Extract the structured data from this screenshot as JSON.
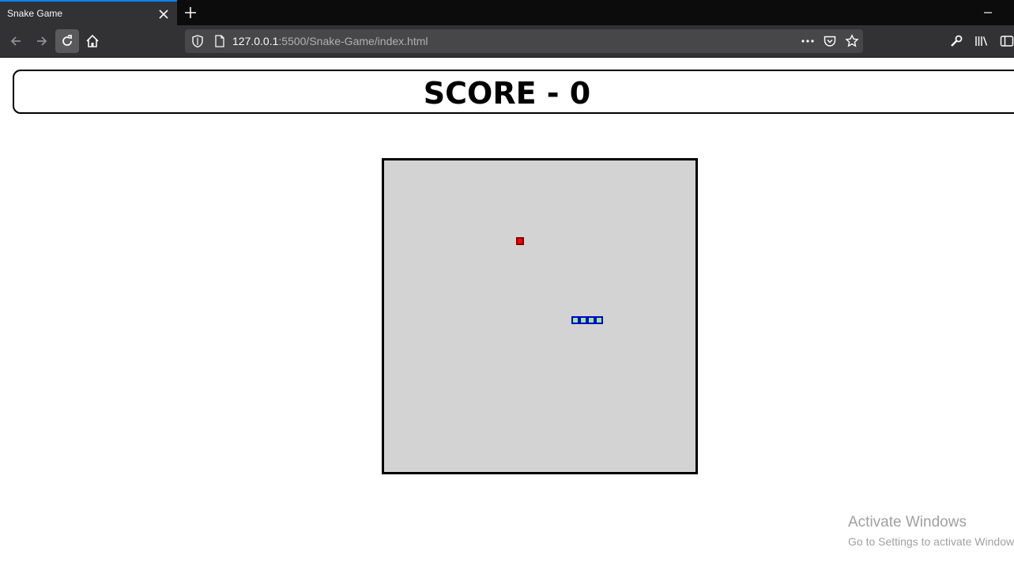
{
  "browser": {
    "tab_title": "Snake Game",
    "url_host": "127.0.0.1",
    "url_rest": ":5500/Snake-Game/index.html"
  },
  "game": {
    "score_text": "SCORE - 0",
    "score": 0,
    "grid_cells": 40,
    "food": {
      "col": 17,
      "row": 10,
      "color": "#ff0000",
      "border": "#800000"
    },
    "snake": {
      "color": "#90ee90",
      "border": "#0000cd",
      "segments": [
        [
          24,
          20
        ],
        [
          25,
          20
        ],
        [
          26,
          20
        ],
        [
          27,
          20
        ]
      ]
    },
    "board_color": "#d3d3d3"
  },
  "os_watermark": {
    "title": "Activate Windows",
    "subtitle": "Go to Settings to activate Windows."
  },
  "colors": {
    "accent": "#0a84ff",
    "chrome_dark": "#0c0c0d",
    "chrome_mid": "#323234"
  }
}
